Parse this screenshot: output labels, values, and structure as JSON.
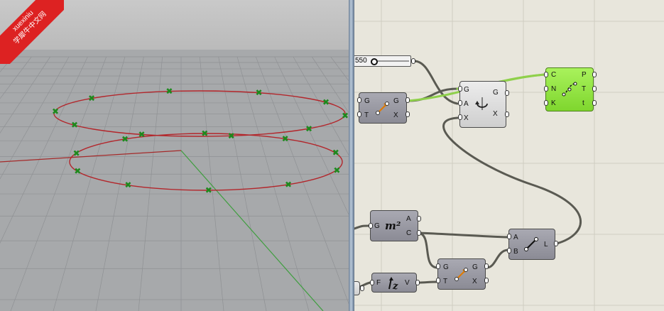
{
  "badge": {
    "line1": "xuexiniu",
    "line2": "学犀牛中文网"
  },
  "canvas": {
    "slider": {
      "value": "550"
    },
    "components": {
      "move": {
        "inputs": [
          "G",
          "T"
        ],
        "outputs": [
          "G",
          "X"
        ]
      },
      "rotate": {
        "inputs": [
          "G",
          "A",
          "X"
        ],
        "outputs": [
          "G",
          "X"
        ]
      },
      "divide": {
        "inputs": [
          "C",
          "N",
          "K"
        ],
        "outputs": [
          "P",
          "T",
          "t"
        ]
      },
      "area": {
        "inputs": [
          "G"
        ],
        "outputs": [
          "A",
          "C"
        ]
      },
      "line": {
        "inputs": [
          "A",
          "B"
        ],
        "outputs": [
          "L"
        ]
      },
      "move2": {
        "inputs": [
          "G",
          "T"
        ],
        "outputs": [
          "G",
          "X"
        ]
      },
      "unitz": {
        "inputs": [
          "F"
        ],
        "outputs": [
          "V"
        ]
      }
    }
  },
  "colors": {
    "curve": "#b3262b",
    "point": "#1d8a1d",
    "wire": "#5a5a52",
    "wire_green": "#8fd04b"
  }
}
